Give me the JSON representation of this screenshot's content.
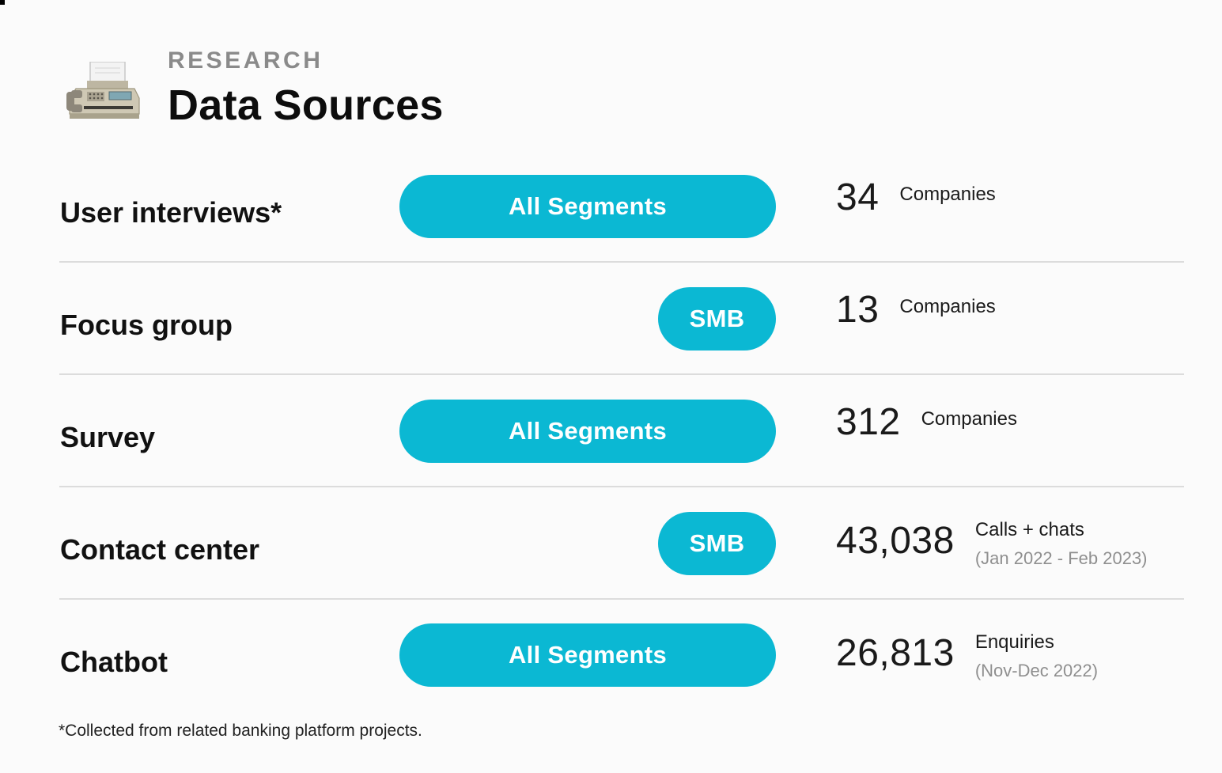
{
  "header": {
    "eyebrow": "RESEARCH",
    "title": "Data Sources",
    "icon": "fax-machine-icon"
  },
  "colors": {
    "accent": "#0bb8d3",
    "background": "#fbfbfb",
    "divider": "#dcdcdc",
    "muted_text": "#8f8f8f"
  },
  "rows": [
    {
      "label": "User interviews*",
      "segment": "All Segments",
      "count": "34",
      "unit": "Companies",
      "note": ""
    },
    {
      "label": "Focus group",
      "segment": "SMB",
      "count": "13",
      "unit": "Companies",
      "note": ""
    },
    {
      "label": "Survey",
      "segment": "All Segments",
      "count": "312",
      "unit": "Companies",
      "note": ""
    },
    {
      "label": "Contact center",
      "segment": "SMB",
      "count": "43,038",
      "unit": "Calls + chats",
      "note": "(Jan 2022 - Feb 2023)"
    },
    {
      "label": "Chatbot",
      "segment": "All Segments",
      "count": "26,813",
      "unit": "Enquiries",
      "note": "(Nov-Dec 2022)"
    }
  ],
  "footnote": "*Collected from related banking platform projects."
}
